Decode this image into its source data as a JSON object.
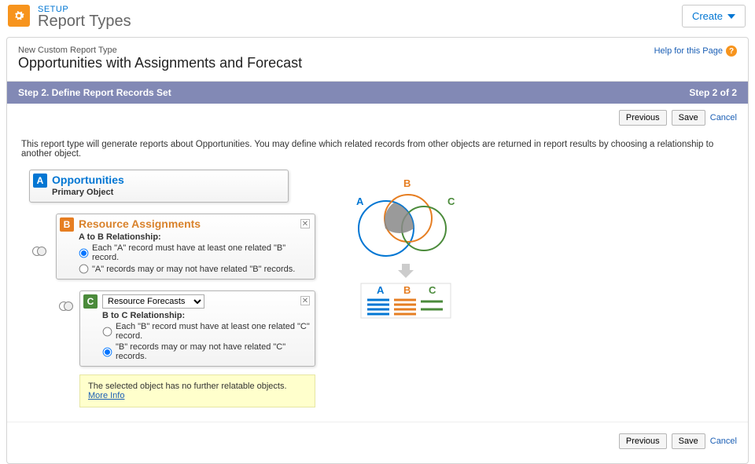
{
  "header": {
    "setup_label": "SETUP",
    "page_title": "Report Types",
    "create_label": "Create"
  },
  "sub_header": {
    "breadcrumb": "New Custom Report Type",
    "title": "Opportunities with Assignments and Forecast",
    "help_label": "Help for this Page"
  },
  "step_bar": {
    "left": "Step 2. Define Report Records Set",
    "right": "Step 2 of 2"
  },
  "buttons": {
    "previous": "Previous",
    "save": "Save",
    "cancel": "Cancel"
  },
  "description": "This report type will generate reports about Opportunities. You may define which related records from other objects are returned in report results by choosing a relationship to another object.",
  "object_a": {
    "letter": "A",
    "title": "Opportunities",
    "subtitle": "Primary Object"
  },
  "object_b": {
    "letter": "B",
    "title": "Resource Assignments",
    "rel_title": "A to B Relationship:",
    "opt1": "Each \"A\" record must have at least one related \"B\" record.",
    "opt2": "\"A\" records may or may not have related \"B\" records."
  },
  "object_c": {
    "letter": "C",
    "select_value": "Resource Forecasts",
    "rel_title": "B to C Relationship:",
    "opt1": "Each \"B\" record must have at least one related \"C\" record.",
    "opt2": "\"B\" records may or may not have related \"C\" records."
  },
  "info_box": {
    "text": "The selected object has no further relatable objects. ",
    "more_info": "More Info"
  },
  "venn_labels": {
    "a": "A",
    "b": "B",
    "c": "C"
  }
}
